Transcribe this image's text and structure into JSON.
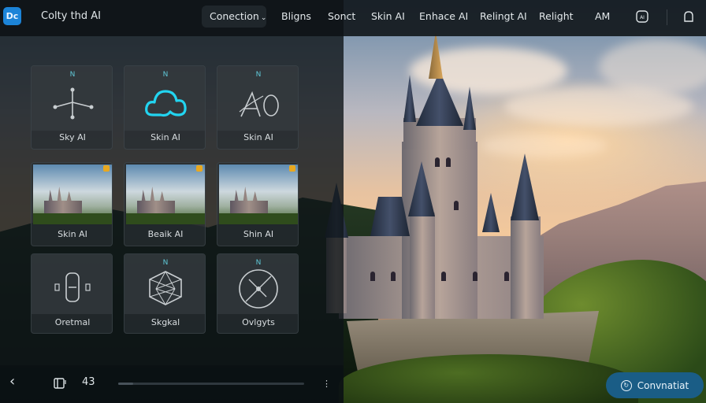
{
  "app": {
    "logo_text": "Dc",
    "title": "Colty thd AI"
  },
  "nav": {
    "items": [
      "Conection",
      "Bligns",
      "Sonct",
      "Skin AI",
      "Enhace AI",
      "Relingt AI",
      "Relight",
      "AM"
    ],
    "active_index": 0
  },
  "top_icons": [
    "ai-icon",
    "user-icon"
  ],
  "cards": [
    {
      "label": "Sky AI",
      "badge": "N",
      "icon": "network-icon"
    },
    {
      "label": "Skin AI",
      "badge": "N",
      "icon": "cloud-icon"
    },
    {
      "label": "Skin AI",
      "badge": "N",
      "icon": "text-ao-icon"
    },
    {
      "label": "Skin AI",
      "icon": "castle-thumbnail"
    },
    {
      "label": "Beaik AI",
      "icon": "castle-thumbnail"
    },
    {
      "label": "Shin AI",
      "icon": "castle-thumbnail"
    },
    {
      "label": "Oretmal",
      "badge": "",
      "icon": "phone-icon"
    },
    {
      "label": "Skgkal",
      "badge": "N",
      "icon": "polygon-icon"
    },
    {
      "label": "Ovlgyts",
      "badge": "N",
      "icon": "compass-icon"
    }
  ],
  "bottom_bar": {
    "back_icon": "chevron-left-icon",
    "layers_icon": "layers-icon",
    "counter": "43",
    "slider_fraction": 0.08
  },
  "cta": {
    "label": "Convnatiat",
    "icon": "convert-icon"
  },
  "colors": {
    "accent": "#1a5d86",
    "logo": "#1c84d8",
    "badge": "#5fc8d8",
    "flag": "#e8a820"
  }
}
